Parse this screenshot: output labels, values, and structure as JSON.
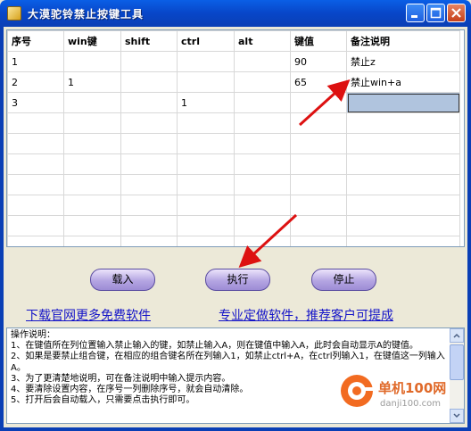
{
  "window": {
    "title": "大漠驼铃禁止按键工具"
  },
  "table": {
    "columns": [
      "序号",
      "win键",
      "shift",
      "ctrl",
      "alt",
      "键值",
      "备注说明"
    ],
    "rows": [
      [
        "1",
        "",
        "",
        "",
        "",
        "90",
        "禁止z"
      ],
      [
        "2",
        "1",
        "",
        "",
        "",
        "65",
        "禁止win+a"
      ],
      [
        "3",
        "",
        "",
        "1",
        "",
        "",
        ""
      ],
      [
        "",
        "",
        "",
        "",
        "",
        "",
        ""
      ],
      [
        "",
        "",
        "",
        "",
        "",
        "",
        ""
      ],
      [
        "",
        "",
        "",
        "",
        "",
        "",
        ""
      ],
      [
        "",
        "",
        "",
        "",
        "",
        "",
        ""
      ],
      [
        "",
        "",
        "",
        "",
        "",
        "",
        ""
      ],
      [
        "",
        "",
        "",
        "",
        "",
        "",
        ""
      ],
      [
        "",
        "",
        "",
        "",
        "",
        "",
        ""
      ]
    ]
  },
  "buttons": {
    "load": "载入",
    "execute": "执行",
    "stop": "停止"
  },
  "links": {
    "download": "下载官网更多免费软件",
    "custom": "专业定做软件，推荐客户可提成"
  },
  "notes": {
    "text": "操作说明：\n1、在键值所在列位置输入禁止输入的键，如禁止输入A，则在键值中输入A，此时会自动显示A的键值。\n2、如果是要禁止组合键，在相应的组合键名所在列输入1，如禁止ctrl+A，在ctrl列输入1，在键值这一列输入A。\n3、为了更清楚地说明，可在备注说明中输入提示内容。\n4、要清除设置内容，在序号一列删除序号，就会自动清除。\n5、打开后会自动载入，只需要点击执行即可。"
  },
  "watermark": {
    "brand": "单机100网",
    "site": "danji100.com"
  },
  "colors": {
    "title_bar": "#0a4fd4",
    "button_face": "#b4a5e2",
    "link": "#1414c8",
    "annotation_arrow": "#dd1111"
  }
}
